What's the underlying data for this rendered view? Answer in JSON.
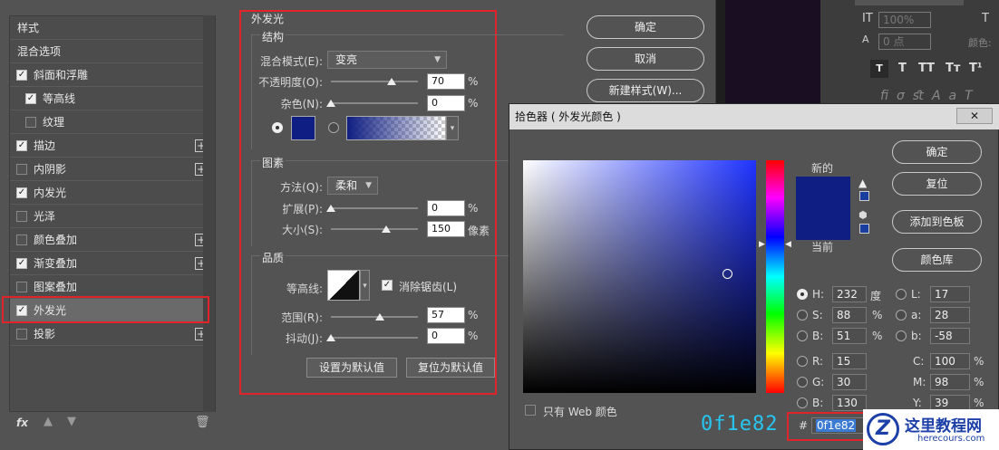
{
  "layer_style": {
    "list_header": "样式",
    "items": [
      {
        "label": "混合选项",
        "checkbox": false,
        "has_checkbox": false,
        "plus": false
      },
      {
        "label": "斜面和浮雕",
        "checkbox": true,
        "has_checkbox": true,
        "plus": false
      },
      {
        "label": "等高线",
        "checkbox": true,
        "has_checkbox": true,
        "plus": false,
        "indent": true
      },
      {
        "label": "纹理",
        "checkbox": false,
        "has_checkbox": true,
        "plus": false,
        "indent": true
      },
      {
        "label": "描边",
        "checkbox": true,
        "has_checkbox": true,
        "plus": true
      },
      {
        "label": "内阴影",
        "checkbox": false,
        "has_checkbox": true,
        "plus": true
      },
      {
        "label": "内发光",
        "checkbox": true,
        "has_checkbox": true,
        "plus": false
      },
      {
        "label": "光泽",
        "checkbox": false,
        "has_checkbox": true,
        "plus": false
      },
      {
        "label": "颜色叠加",
        "checkbox": false,
        "has_checkbox": true,
        "plus": true
      },
      {
        "label": "渐变叠加",
        "checkbox": true,
        "has_checkbox": true,
        "plus": true
      },
      {
        "label": "图案叠加",
        "checkbox": false,
        "has_checkbox": true,
        "plus": false
      },
      {
        "label": "外发光",
        "checkbox": true,
        "has_checkbox": true,
        "plus": false,
        "selected": true
      },
      {
        "label": "投影",
        "checkbox": false,
        "has_checkbox": true,
        "plus": true
      }
    ],
    "footer_fx": "fx"
  },
  "outer_glow": {
    "title": "外发光",
    "structure": {
      "title": "结构",
      "blend_mode_label": "混合模式(E):",
      "blend_mode_value": "变亮",
      "opacity_label": "不透明度(O):",
      "opacity_value": "70",
      "noise_label": "杂色(N):",
      "noise_value": "0",
      "percent": "%",
      "glow_color": "#0f1e82"
    },
    "elements": {
      "title": "图素",
      "method_label": "方法(Q):",
      "method_value": "柔和",
      "spread_label": "扩展(P):",
      "spread_value": "0",
      "size_label": "大小(S):",
      "size_value": "150",
      "size_unit": "像素",
      "percent": "%"
    },
    "quality": {
      "title": "品质",
      "contour_label": "等高线:",
      "anti_alias_label": "消除锯齿(L)",
      "range_label": "范围(R):",
      "range_value": "57",
      "jitter_label": "抖动(J):",
      "jitter_value": "0",
      "percent": "%"
    },
    "make_default": "设置为默认值",
    "reset_default": "复位为默认值"
  },
  "dialog_buttons": {
    "ok": "确定",
    "cancel": "取消",
    "new_style": "新建样式(W)..."
  },
  "color_picker": {
    "title": "拾色器 ( 外发光颜色 )",
    "new_label": "新的",
    "current_label": "当前",
    "ok": "确定",
    "reset": "复位",
    "add_swatch": "添加到色板",
    "libraries": "颜色库",
    "web_only": "只有 Web 颜色",
    "hsb": {
      "H": "232",
      "H_unit": "度",
      "S": "88",
      "S_unit": "%",
      "B": "51",
      "B_unit": "%"
    },
    "lab": {
      "L": "17",
      "a": "28",
      "b": "-58"
    },
    "rgb": {
      "R": "15",
      "G": "30",
      "B": "130"
    },
    "cmyk": {
      "C": "100",
      "M": "98",
      "Y": "39",
      "unit": "%"
    },
    "hash": "#",
    "hex": "0f1e82",
    "hex_big": "0f1e82",
    "new_color": "#0f1e82",
    "current_color": "#0f1e82"
  },
  "right_panel": {
    "scale_v": "100%",
    "tracking": "0 点",
    "color_label": "颜色:",
    "tt_buttons": [
      "T",
      "T",
      "TT",
      "Tт",
      "T¹"
    ]
  },
  "watermark": {
    "title": "这里教程网",
    "url": "herecours.com"
  },
  "colors": {
    "accent_red": "#e0242a",
    "hex_cyan": "#26c6f0",
    "selection_blue": "#3b7bd4"
  }
}
